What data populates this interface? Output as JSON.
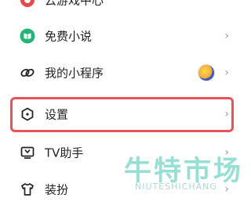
{
  "menu": {
    "items": [
      {
        "label": "云游戏中心",
        "icon": "cloud-game-icon"
      },
      {
        "label": "免费小说",
        "icon": "book-icon"
      },
      {
        "label": "我的小程序",
        "icon": "mini-program-icon"
      },
      {
        "label": "设置",
        "icon": "settings-icon"
      },
      {
        "label": "TV助手",
        "icon": "tv-icon"
      },
      {
        "label": "装扮",
        "icon": "tshirt-icon"
      }
    ],
    "chevron": "›"
  },
  "watermark": {
    "cn": "牛特市场",
    "en": "NIUTESHICHANG"
  },
  "colors": {
    "highlight": "#e8525a",
    "book_icon": "#23b575",
    "cloud_icon": "#e84848",
    "text": "#222222",
    "chevron": "#9a9a9a"
  }
}
